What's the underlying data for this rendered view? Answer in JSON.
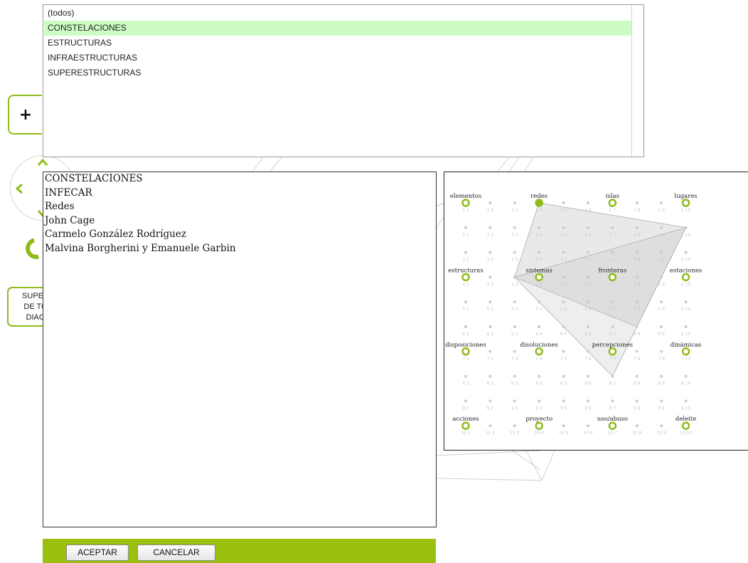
{
  "zoom_button": {
    "label": "+"
  },
  "navigation": {
    "up_arrow": "^",
    "left_arrow": "<",
    "down_arrow": "v"
  },
  "super_button": {
    "lines": [
      "SUPER",
      "DE TO",
      "DIAG"
    ]
  },
  "category_list": {
    "items": [
      "(todos)",
      "CONSTELACIONES",
      "ESTRUCTURAS",
      "INFRAESTRUCTURAS",
      "SUPERESTRUCTURAS"
    ],
    "selected": "CONSTELACIONES"
  },
  "main_list": {
    "items": [
      "CONSTELACIONES",
      "INFECAR",
      "Redes",
      "John Cage",
      "Carmelo González Rodríguez",
      "Malvina Borgherini y Emanuele Garbin"
    ]
  },
  "footer": {
    "accept_label": "ACEPTAR",
    "cancel_label": "CANCELAR"
  },
  "diagram": {
    "accent_color": "#8fbc1a",
    "row_labels": [
      [
        "elementos",
        "redes",
        "islas",
        "lugares"
      ],
      [
        "estructuras",
        "sistemas",
        "fronteras",
        "estaciones"
      ],
      [
        "disposiciones",
        "disoluciones",
        "percepciones",
        "dinámicas"
      ],
      [
        "acciones",
        "proyecto",
        "uso/abuso",
        "deleite"
      ]
    ],
    "active_node": "redes"
  }
}
